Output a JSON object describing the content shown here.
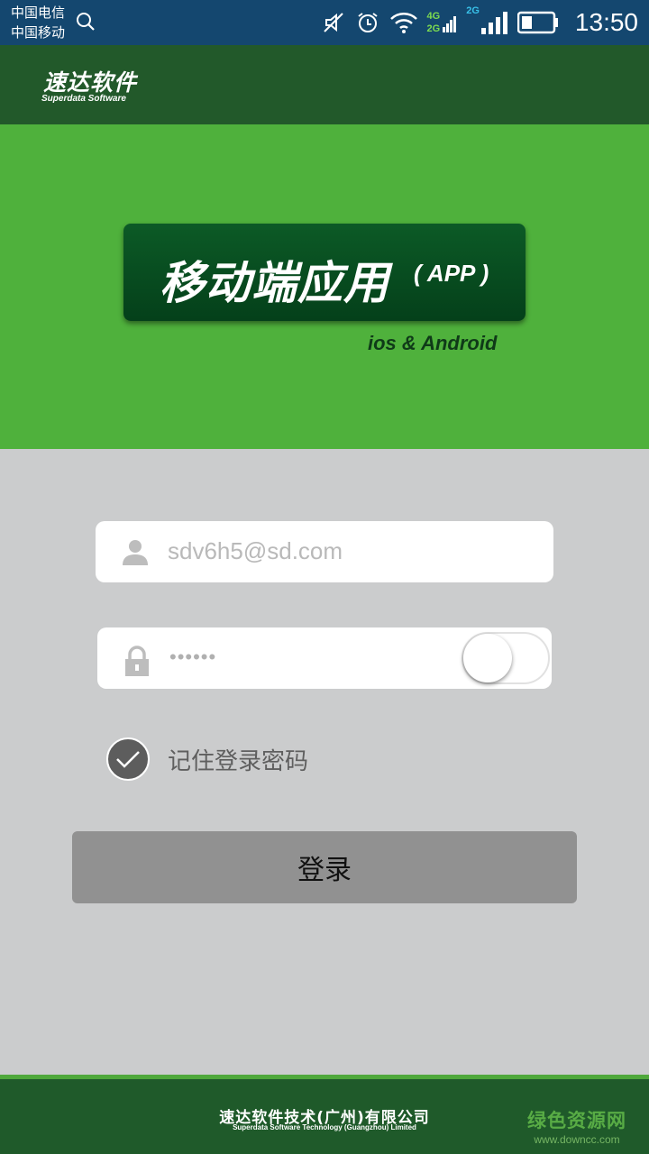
{
  "status_bar": {
    "carrier_1": "中国电信",
    "carrier_2": "中国移动",
    "net_1_top": "4G",
    "net_1_bottom": "2G",
    "net_2": "2G",
    "time": "13:50",
    "icons": [
      "search-icon",
      "mute-icon",
      "alarm-icon",
      "wifi-icon",
      "signal-icon",
      "battery-icon"
    ],
    "colors": {
      "background": "#14476f",
      "net_4g": "#7ddc50",
      "net_2g": "#38c0e8"
    }
  },
  "header": {
    "logo_cn": "速达软件",
    "logo_en": "Superdata Software"
  },
  "banner": {
    "title": "移动端应用",
    "title_suffix": "( APP )",
    "platforms": "ios & Android"
  },
  "login_form": {
    "username_value": "sdv6h5@sd.com",
    "password_mask": "••••••",
    "show_password_toggle": false,
    "remember_checked": true,
    "remember_label": "记住登录密码",
    "submit_label": "登录"
  },
  "footer": {
    "company_cn": "速达软件技术(广州)有限公司",
    "company_en": "Superdata Software Technology (Guangzhou) Limited",
    "watermark_cn": "绿色资源网",
    "watermark_url": "www.downcc.com"
  },
  "colors": {
    "appbar": "#22592a",
    "banner": "#4fb13c",
    "page_background": "#cbcccd",
    "login_button": "#919191"
  }
}
